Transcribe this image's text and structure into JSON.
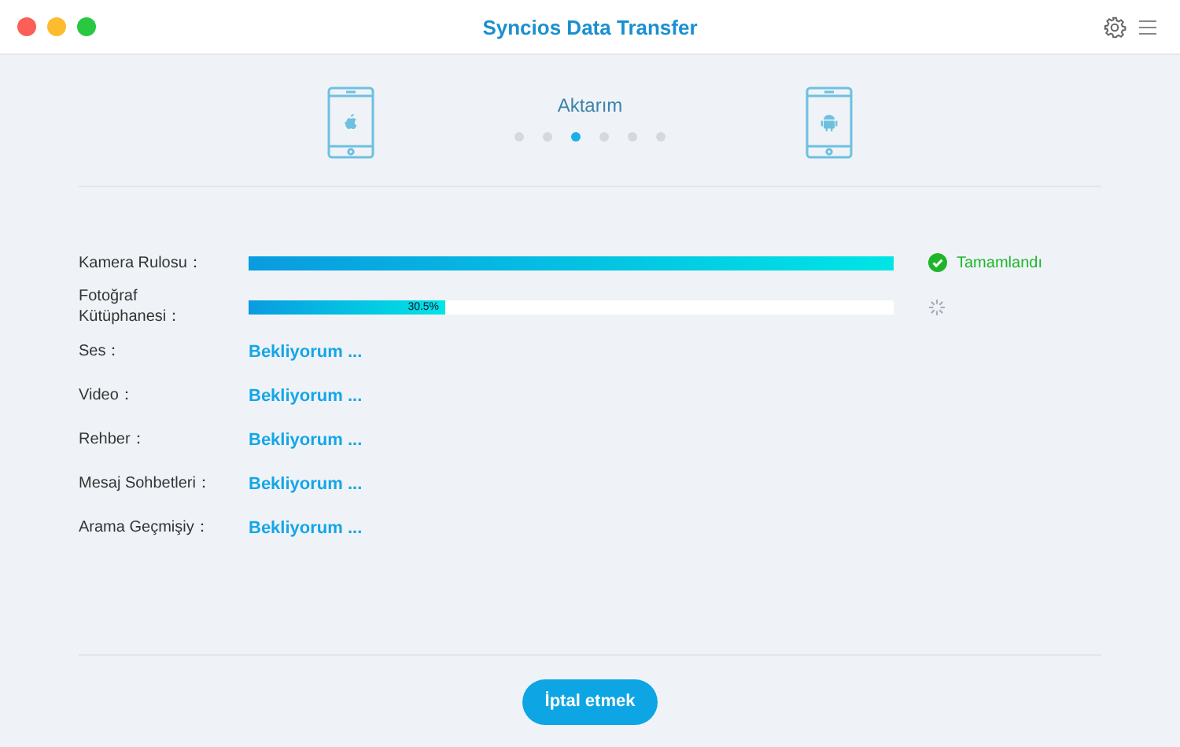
{
  "window": {
    "title": "Syncios Data Transfer"
  },
  "transfer": {
    "label": "Aktarım",
    "steps": [
      {
        "selected": false
      },
      {
        "selected": false
      },
      {
        "selected": true
      },
      {
        "selected": false
      },
      {
        "selected": false
      },
      {
        "selected": false
      }
    ]
  },
  "items": [
    {
      "kind": "done",
      "label": "Kamera Rulosu：",
      "level": 1,
      "status": "Tamamlandı"
    },
    {
      "kind": "progress",
      "label": "Fotoğraf Kütüphanesi：",
      "level": 0.305,
      "reading": "30.5%"
    },
    {
      "kind": "waiting",
      "label": "Ses：",
      "status": "Bekliyorum ..."
    },
    {
      "kind": "waiting",
      "label": "Video：",
      "status": "Bekliyorum ..."
    },
    {
      "kind": "waiting",
      "label": "Rehber：",
      "status": "Bekliyorum ..."
    },
    {
      "kind": "waiting",
      "label": "Mesaj Sohbetleri：",
      "status": "Bekliyorum ..."
    },
    {
      "kind": "waiting",
      "label": "Arama Geçmişiy：",
      "status": "Bekliyorum ..."
    }
  ],
  "cancel_button": "İptal etmek"
}
